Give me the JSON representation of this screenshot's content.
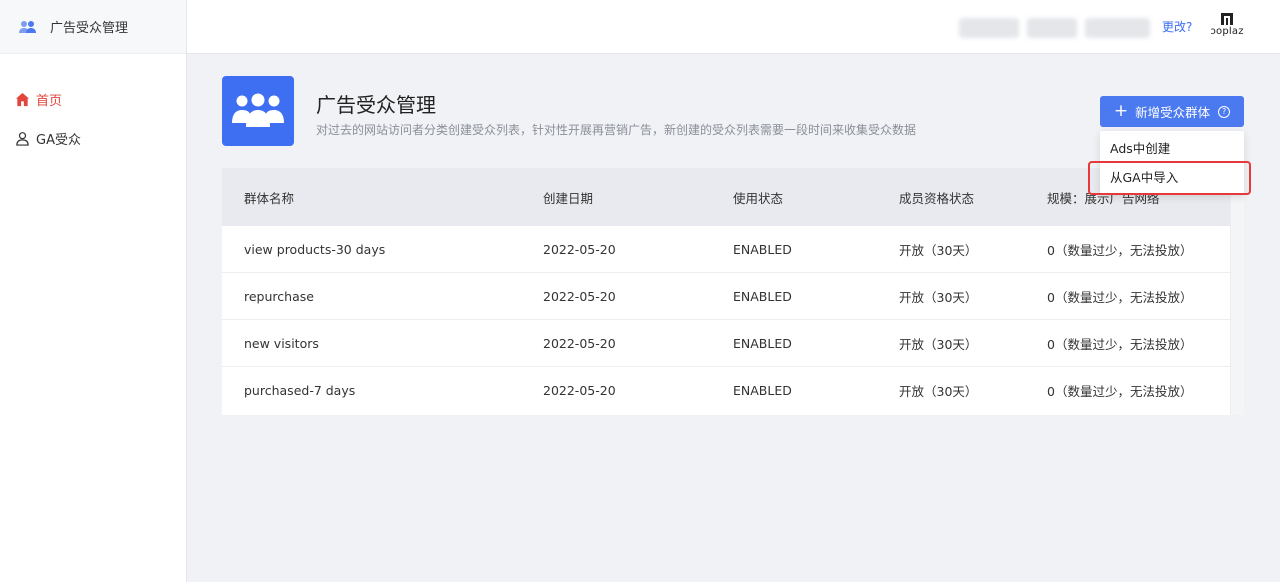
{
  "sidebar": {
    "title": "广告受众管理",
    "items": [
      {
        "label": "首页",
        "icon": "home-icon",
        "active": true
      },
      {
        "label": "GA受众",
        "icon": "user-icon",
        "active": false
      }
    ]
  },
  "topbar": {
    "change_link": "更改?",
    "brand_text": "ɔoplaz"
  },
  "header": {
    "title": "广告受众管理",
    "description": "对过去的网站访问者分类创建受众列表，针对性开展再营销广告，新创建的受众列表需要一段时间来收集受众数据",
    "add_button": "新增受众群体",
    "help_icon_text": "?"
  },
  "dropdown": {
    "items": [
      "Ads中创建",
      "从GA中导入"
    ]
  },
  "table": {
    "columns": [
      "群体名称",
      "创建日期",
      "使用状态",
      "成员资格状态",
      "规模：展示广告网络"
    ],
    "rows": [
      [
        "view products-30 days",
        "2022-05-20",
        "ENABLED",
        "开放（30天）",
        "0（数量过少，无法投放）"
      ],
      [
        "repurchase",
        "2022-05-20",
        "ENABLED",
        "开放（30天）",
        "0（数量过少，无法投放）"
      ],
      [
        "new visitors",
        "2022-05-20",
        "ENABLED",
        "开放（30天）",
        "0（数量过少，无法投放）"
      ],
      [
        "purchased-7 days",
        "2022-05-20",
        "ENABLED",
        "开放（30天）",
        "0（数量过少，无法投放）"
      ]
    ]
  },
  "colors": {
    "accent": "#4b79f0",
    "active_nav": "#e2453c",
    "highlight": "#e5393b"
  }
}
